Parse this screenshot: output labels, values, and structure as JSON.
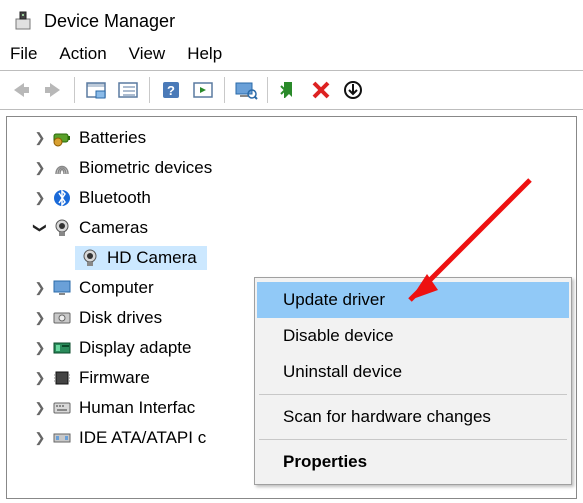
{
  "window": {
    "title": "Device Manager"
  },
  "menu": {
    "items": [
      "File",
      "Action",
      "View",
      "Help"
    ]
  },
  "toolbar_icons": [
    "back-icon",
    "forward-icon",
    "sep",
    "show-hidden-icon",
    "resources-icon",
    "sep",
    "help-icon",
    "legacy-icon",
    "sep",
    "scan-icon",
    "sep",
    "update-driver-icon",
    "uninstall-icon",
    "disable-icon"
  ],
  "tree": {
    "nodes": [
      {
        "expand": "collapsed",
        "icon": "battery-icon",
        "label": "Batteries"
      },
      {
        "expand": "collapsed",
        "icon": "fingerprint-icon",
        "label": "Biometric devices"
      },
      {
        "expand": "collapsed",
        "icon": "bluetooth-icon",
        "label": "Bluetooth"
      },
      {
        "expand": "expanded",
        "icon": "camera-icon",
        "label": "Cameras",
        "children": [
          {
            "icon": "camera-icon",
            "label": "HD Camera",
            "selected": true
          }
        ]
      },
      {
        "expand": "collapsed",
        "icon": "monitor-icon",
        "label": "Computer"
      },
      {
        "expand": "collapsed",
        "icon": "disk-icon",
        "label": "Disk drives"
      },
      {
        "expand": "collapsed",
        "icon": "display-adapter-icon",
        "label": "Display adapte"
      },
      {
        "expand": "collapsed",
        "icon": "firmware-icon",
        "label": "Firmware"
      },
      {
        "expand": "collapsed",
        "icon": "hid-icon",
        "label": "Human Interfac"
      },
      {
        "expand": "collapsed",
        "icon": "ide-icon",
        "label": "IDE ATA/ATAPI c"
      }
    ]
  },
  "context_menu": {
    "items": [
      {
        "label": "Update driver",
        "highlight": true
      },
      {
        "label": "Disable device"
      },
      {
        "label": "Uninstall device"
      },
      {
        "sep": true
      },
      {
        "label": "Scan for hardware changes"
      },
      {
        "sep": true
      },
      {
        "label": "Properties",
        "bold": true
      }
    ]
  }
}
